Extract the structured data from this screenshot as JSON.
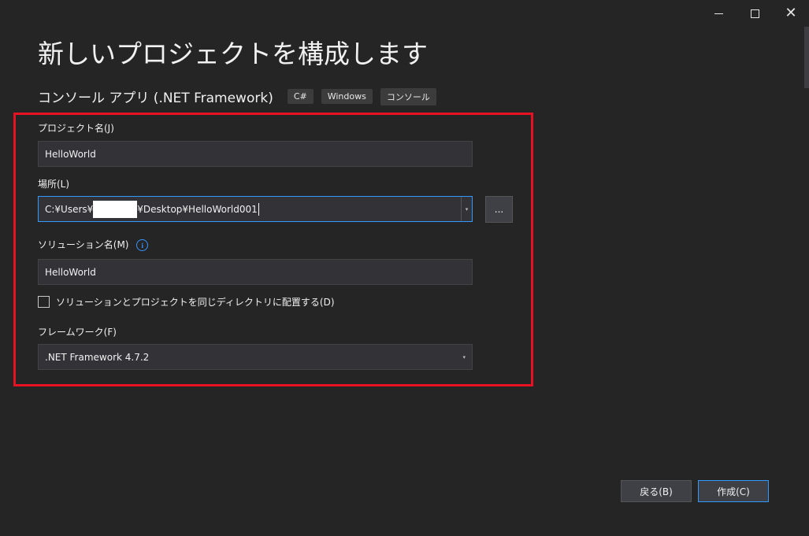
{
  "window": {
    "minimize_icon": "minimize-icon",
    "maximize_icon": "maximize-icon",
    "close_icon": "close-icon",
    "close_glyph": "✕"
  },
  "page": {
    "title": "新しいプロジェクトを構成します"
  },
  "template": {
    "name": "コンソール アプリ (.NET Framework)",
    "tags": [
      "C#",
      "Windows",
      "コンソール"
    ]
  },
  "form": {
    "project_name": {
      "label": "プロジェクト名(J)",
      "value": "HelloWorld"
    },
    "location": {
      "label": "場所(L)",
      "value_prefix": "C:¥Users¥",
      "value_suffix": "¥Desktop¥HelloWorld001",
      "arrow_glyph": "▾"
    },
    "browse_button": {
      "label": "..."
    },
    "solution_name": {
      "label": "ソリューション名(M)",
      "info_glyph": "i",
      "value": "HelloWorld"
    },
    "same_directory_checkbox": {
      "label": "ソリューションとプロジェクトを同じディレクトリに配置する(D)",
      "checked": false
    },
    "framework": {
      "label": "フレームワーク(F)",
      "value": ".NET Framework 4.7.2",
      "arrow_glyph": "▾"
    }
  },
  "footer": {
    "back_label": "戻る(B)",
    "create_label": "作成(C)"
  },
  "colors": {
    "background": "#252526",
    "highlight": "#e81123",
    "accent": "#3399ff"
  }
}
